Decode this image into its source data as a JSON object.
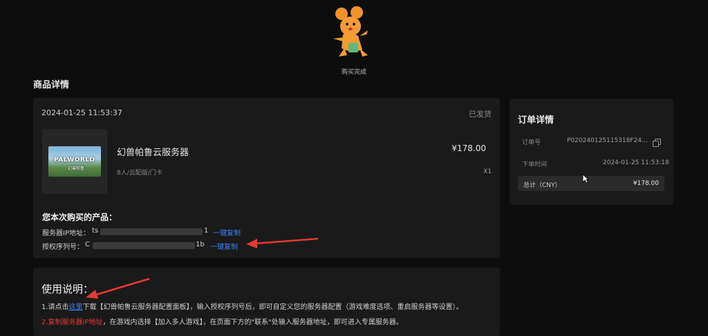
{
  "header": {
    "success_text": "购买完成",
    "mascot_icon": "mouse-mascot-icon"
  },
  "section_title": "商品详情",
  "order": {
    "time": "2024-01-25 11:53:37",
    "status": "已发货",
    "product": {
      "thumb_logo": "PALWORLD",
      "thumb_sub": "幻兽帕鲁",
      "name": "幻兽帕鲁云服务器",
      "spec": "8人/云配版/门卡",
      "price": "¥178.00",
      "qty": "X1"
    },
    "purchased_heading": "您本次购买的产品：",
    "server_ip": {
      "label": "服务器IP地址：",
      "value_prefix": "ts",
      "value_suffix": "1",
      "copy_label": "一键复制"
    },
    "license": {
      "label": "授权序列号：",
      "value_prefix": "C",
      "value_suffix": "1b",
      "copy_label": "一键复制"
    }
  },
  "order_detail": {
    "title": "订单详情",
    "order_no_label": "订单号",
    "order_no_value": "P020240125115318F24...",
    "order_time_label": "下单时间",
    "order_time_value": "2024-01-25 11:53:18",
    "total_label": "总计（CNY）",
    "total_value": "¥178.00",
    "copy_icon": "copy-icon"
  },
  "instructions": {
    "title": "使用说明：",
    "line1_a": "1.请点击",
    "line1_link": "这里",
    "line1_b": "下载【幻兽帕鲁云服务器配置面板】，输入授权序列号后，即可自定义您的服务器配置（游戏难度选项、重启服务器等设置）。",
    "line2_a": "2.复制",
    "line2_red": "服务器IP地址",
    "line2_b": "，在游戏内选择【加入多人游戏】，在页面下方的\"联系\"处输入服务器地址，即可进入专属服务器。"
  },
  "colors": {
    "background": "#0d0d0d",
    "card": "#1a1a1a",
    "link_blue": "#3b82f6",
    "annotation_red": "#e53935"
  }
}
